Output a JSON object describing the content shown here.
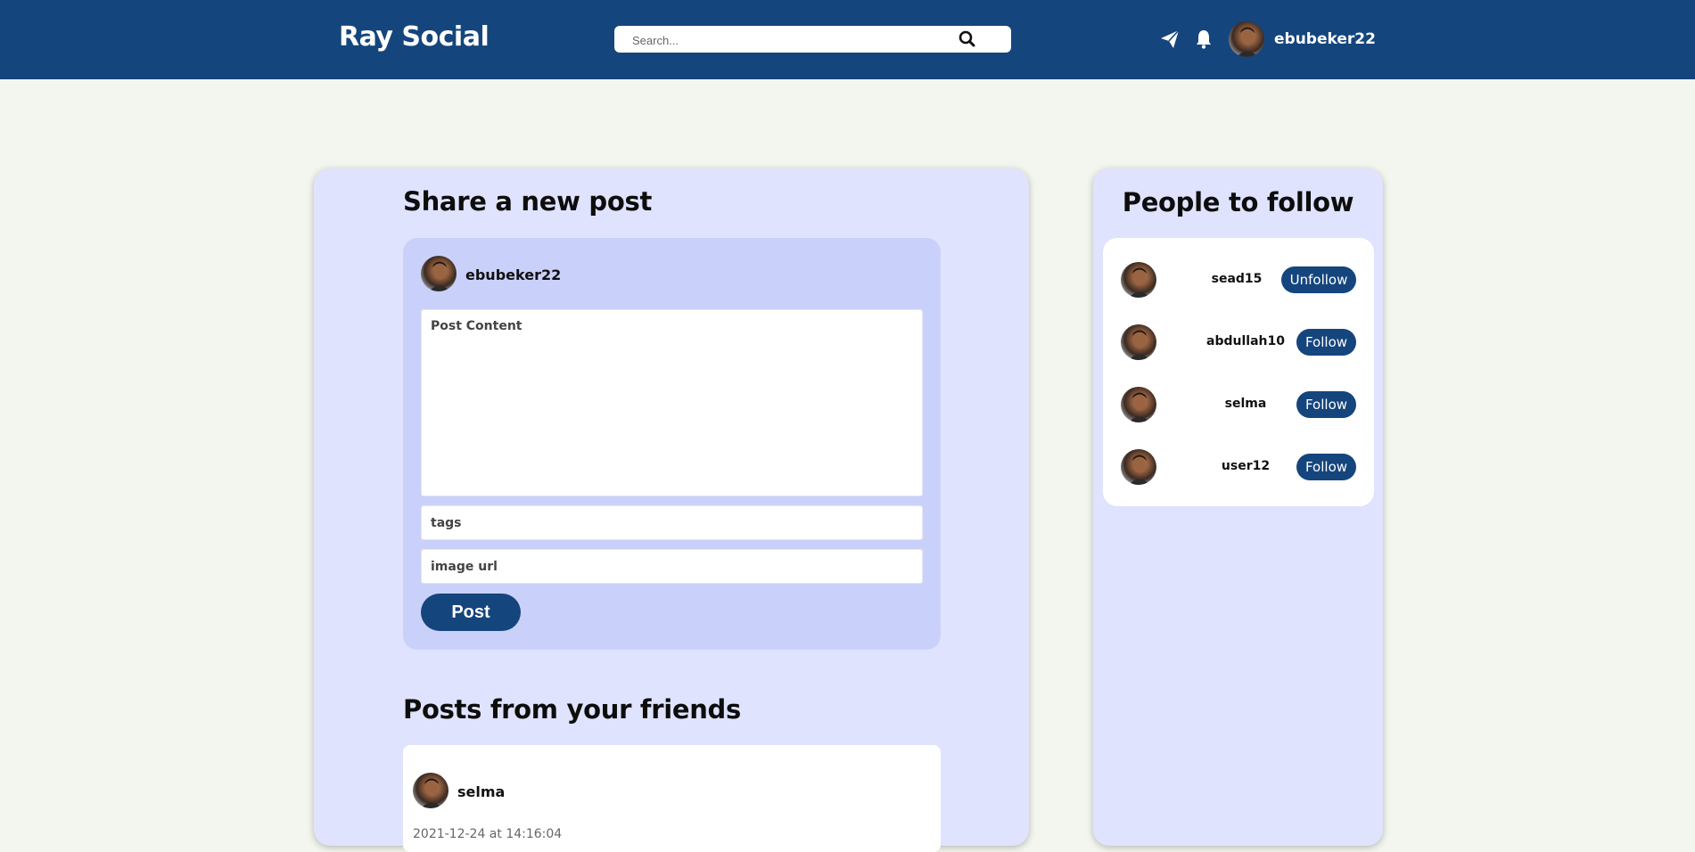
{
  "header": {
    "brand": "Ray Social",
    "search_placeholder": "Search...",
    "username": "ebubeker22",
    "colors": {
      "bar": "#15457d",
      "background": "#f3f6ee"
    }
  },
  "composer": {
    "title": "Share a new post",
    "username": "ebubeker22",
    "content_placeholder": "Post Content",
    "tags_placeholder": "tags",
    "image_placeholder": "image url",
    "post_label": "Post"
  },
  "feed": {
    "title": "Posts from your friends",
    "posts": [
      {
        "username": "selma",
        "timestamp": "2021-12-24 at 14:16:04"
      }
    ]
  },
  "sidebar": {
    "title": "People to follow",
    "people": [
      {
        "username": "sead15",
        "action": "Unfollow"
      },
      {
        "username": "abdullah10",
        "action": "Follow"
      },
      {
        "username": "selma",
        "action": "Follow"
      },
      {
        "username": "user12",
        "action": "Follow"
      }
    ]
  },
  "icons": [
    "search-icon",
    "send-icon",
    "bell-icon",
    "avatar"
  ]
}
